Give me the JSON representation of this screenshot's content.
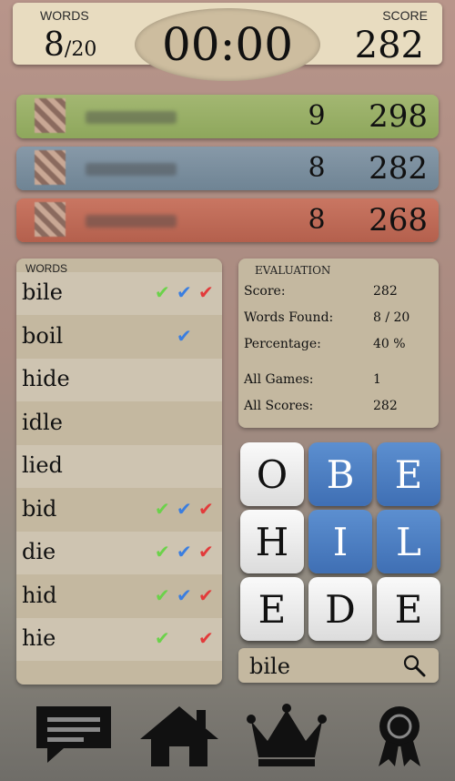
{
  "header": {
    "words_label": "WORDS",
    "words_found": "8",
    "words_total": "/20",
    "timer": "00:00",
    "score_label": "SCORE",
    "score": "282"
  },
  "players": [
    {
      "words": "9",
      "score": "298",
      "color": "#9cb26a"
    },
    {
      "words": "8",
      "score": "282",
      "color": "#7d8f9e"
    },
    {
      "words": "8",
      "score": "268",
      "color": "#c06b57"
    }
  ],
  "words_panel": {
    "title": "WORDS",
    "words": [
      {
        "word": "bile",
        "green": true,
        "blue": true,
        "red": true
      },
      {
        "word": "boil",
        "green": false,
        "blue": true,
        "red": false
      },
      {
        "word": "hide",
        "green": false,
        "blue": false,
        "red": false
      },
      {
        "word": "idle",
        "green": false,
        "blue": false,
        "red": false
      },
      {
        "word": "lied",
        "green": false,
        "blue": false,
        "red": false
      },
      {
        "word": "bid",
        "green": true,
        "blue": true,
        "red": true
      },
      {
        "word": "die",
        "green": true,
        "blue": true,
        "red": true
      },
      {
        "word": "hid",
        "green": true,
        "blue": true,
        "red": true
      },
      {
        "word": "hie",
        "green": true,
        "blue": false,
        "red": true
      }
    ]
  },
  "evaluation": {
    "title": "EVALUATION",
    "score_label": "Score:",
    "score_value": "282",
    "words_found_label": "Words Found:",
    "words_found_value": "8 / 20",
    "percentage_label": "Percentage:",
    "percentage_value": "40 %",
    "all_games_label": "All Games:",
    "all_games_value": "1",
    "all_scores_label": "All Scores:",
    "all_scores_value": "282"
  },
  "board": {
    "tiles": [
      {
        "letter": "O",
        "selected": false
      },
      {
        "letter": "B",
        "selected": true
      },
      {
        "letter": "E",
        "selected": true
      },
      {
        "letter": "H",
        "selected": false
      },
      {
        "letter": "I",
        "selected": true
      },
      {
        "letter": "L",
        "selected": true
      },
      {
        "letter": "E",
        "selected": false
      },
      {
        "letter": "D",
        "selected": false
      },
      {
        "letter": "E",
        "selected": false
      }
    ]
  },
  "search": {
    "value": "bile"
  },
  "nav": [
    "chat-icon",
    "home-icon",
    "crown-icon",
    "award-icon"
  ]
}
